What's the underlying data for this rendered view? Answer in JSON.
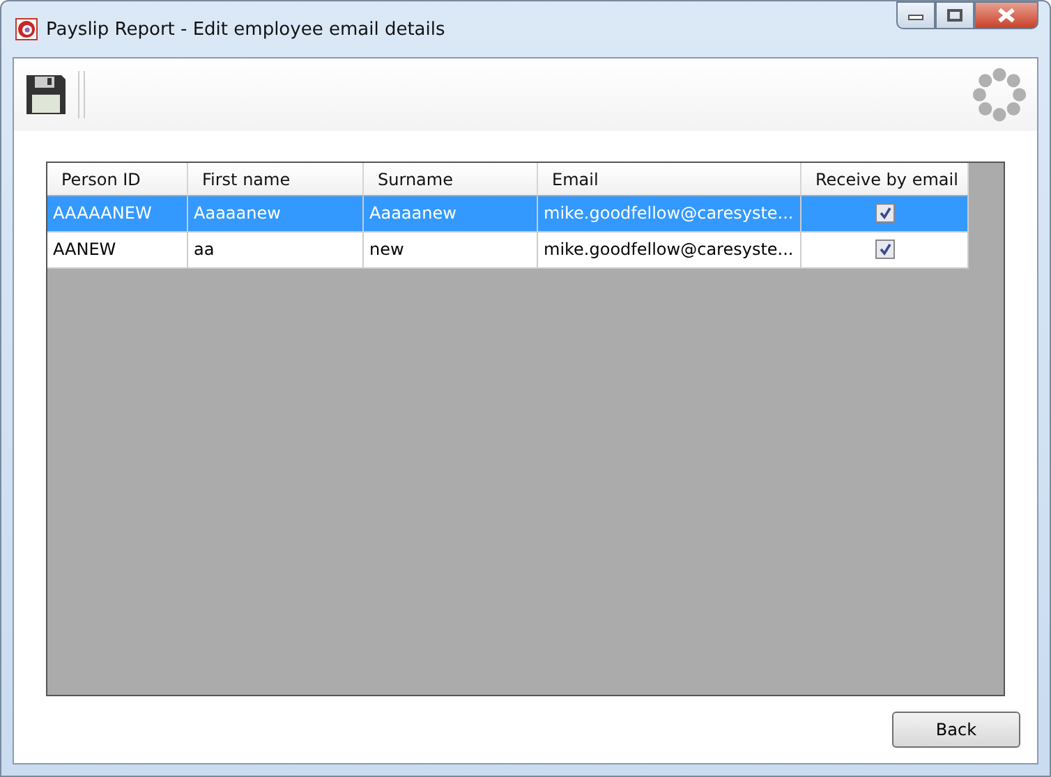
{
  "window": {
    "title": "Payslip Report - Edit employee email details"
  },
  "table": {
    "columns": [
      "Person ID",
      "First name",
      "Surname",
      "Email",
      "Receive by email"
    ],
    "rows": [
      {
        "selected": true,
        "cells": [
          "AAAAANEW",
          "Aaaaanew",
          "Aaaaanew",
          "mike.goodfellow@caresyste..."
        ],
        "checked": true
      },
      {
        "selected": false,
        "cells": [
          "AANEW",
          "aa",
          "new",
          "mike.goodfellow@caresyste..."
        ],
        "checked": true
      }
    ]
  },
  "buttons": [
    "Back"
  ]
}
